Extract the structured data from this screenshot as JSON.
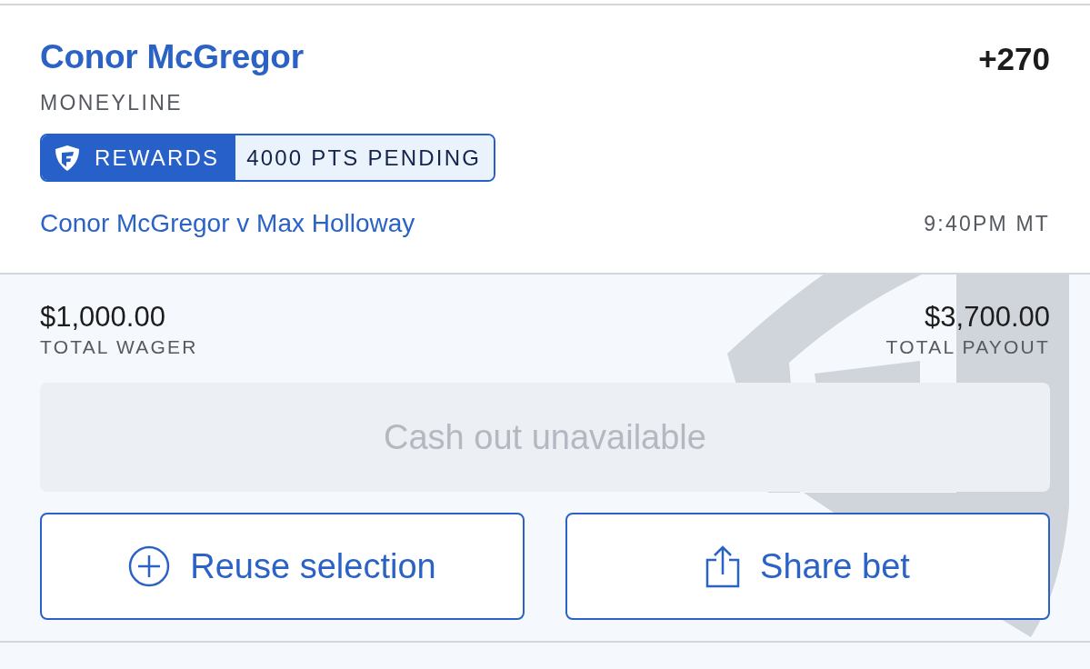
{
  "selection": {
    "name": "Conor McGregor",
    "odds": "+270",
    "market": "MONEYLINE",
    "rewards": {
      "label": "REWARDS",
      "points": "4000 PTS PENDING"
    },
    "event": "Conor McGregor v Max Holloway",
    "time": "9:40PM MT"
  },
  "summary": {
    "wager": {
      "amount": "$1,000.00",
      "label": "TOTAL WAGER"
    },
    "payout": {
      "amount": "$3,700.00",
      "label": "TOTAL PAYOUT"
    }
  },
  "cash_out": {
    "label": "Cash out unavailable",
    "disabled": true
  },
  "actions": [
    {
      "kind": "reuse",
      "label": "Reuse selection"
    },
    {
      "kind": "share",
      "label": "Share bet"
    }
  ]
}
